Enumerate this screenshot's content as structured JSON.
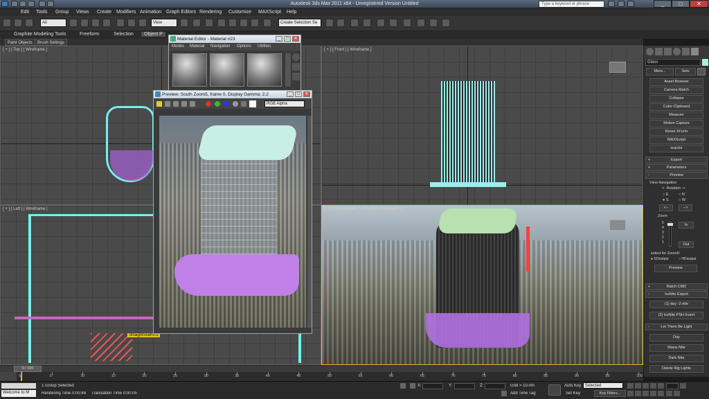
{
  "window": {
    "title": "Autodesk 3ds Max 2011 x64  -  Unregistered Version   Untitled",
    "search_placeholder": "Type a keyword or phrase"
  },
  "menu": [
    "Edit",
    "Tools",
    "Group",
    "Views",
    "Create",
    "Modifiers",
    "Animation",
    "Graph Editors",
    "Rendering",
    "Customize",
    "MAXScript",
    "Help"
  ],
  "toolbar": {
    "selection_filter": "All",
    "reference_coord": "View",
    "named_selection": "Create Selection Se"
  },
  "ribbon": {
    "tabs": [
      "Graphite Modeling Tools",
      "Freeform",
      "Selection",
      "Object P"
    ],
    "sub_tabs": [
      "Paint Objects",
      "Brush Settings"
    ]
  },
  "viewports": {
    "top": "[ + ] [ Top ] [ Wireframe ]",
    "front": "[ + ] [ Front ] [ Wireframe ]",
    "left": "[ + ] [ Left ] [ Wireframe ]",
    "perspective": "[ + ] [ Perspective ] [ Smooth + Highlights ]",
    "object_label": "StraightStair001"
  },
  "material_editor": {
    "title": "Material Editor - Material #23",
    "menus": [
      "Modes",
      "Material",
      "Navigation",
      "Options",
      "Utilities"
    ]
  },
  "preview_window": {
    "title": "Preview: South Zoom5, frame 0, Display Gamma: 2.2",
    "channel": "RGB Alpha"
  },
  "command_panel": {
    "object_name": "Glass",
    "top_buttons": [
      "More...",
      "Sets"
    ],
    "utilities": [
      "Asset Browser",
      "Camera Match",
      "Collapse",
      "Color Clipboard",
      "Measure",
      "Motion Capture",
      "Reset XForm",
      "MAXScript",
      "reactor"
    ],
    "rollouts": [
      "Export",
      "Parameters",
      "Preview"
    ],
    "view_nav_label": "View Navigation",
    "rotation_label": "<- Rotation ->",
    "radio_e": "E",
    "radio_n": "N",
    "radio_s": "S",
    "radio_w": "W",
    "arrow_left": "<--",
    "arrow_right": "-->",
    "zoom_label": "Zoom",
    "zoom_levels": [
      "5",
      "4",
      "3",
      "2",
      "1"
    ],
    "zoom_in": "In",
    "zoom_out": "Out",
    "select_for_label": "select for Zoom5:",
    "opt_1": "SOoutput",
    "opt_2": "HDoutput",
    "preview_button": "Preview",
    "batch_cmd": "Batch CMD",
    "trunite_export": "truNite Export",
    "day2nite": "(1) day -2-nite",
    "trunite_psh": "(2) truNite PSH Insert",
    "let_there_be_light": "Let There Be Light",
    "light_buttons": [
      "Day",
      "Maxis Nite",
      "Dark Nite",
      "Delete Rig Lights"
    ]
  },
  "timeline": {
    "frame_counter": "0 / 100",
    "ticks": [
      "0",
      "5",
      "10",
      "15",
      "20",
      "25",
      "30",
      "35",
      "40",
      "45",
      "50",
      "55",
      "60",
      "65",
      "70",
      "75",
      "80",
      "85",
      "90",
      "95",
      "100"
    ]
  },
  "status": {
    "group_selected": "1 Group Selected",
    "rendering_time": "Rendering Time  0:00:48",
    "translation_time": "Translation Time  0:00:05",
    "welcome": "Welcome to M",
    "x_label": "X:",
    "y_label": "Y:",
    "z_label": "Z:",
    "grid": "Grid = 10.0m",
    "add_time_tag": "Add Time Tag",
    "auto_key": "Auto Key",
    "set_key": "Set Key",
    "auto_key_mode": "Selected",
    "key_filters": "Key Filters..."
  }
}
